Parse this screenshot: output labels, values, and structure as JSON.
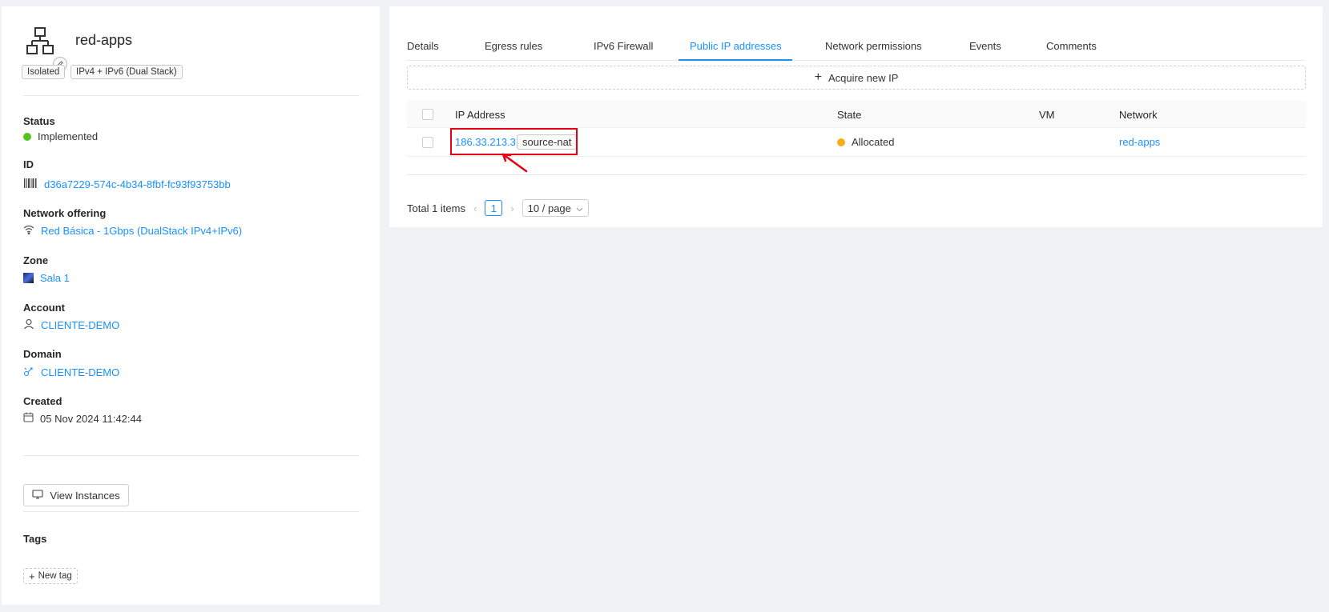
{
  "network": {
    "title": "red-apps",
    "tags": [
      "Isolated",
      "IPv4 + IPv6 (Dual Stack)"
    ]
  },
  "fields": {
    "status": {
      "label": "Status",
      "value": "Implemented",
      "color": "#52c41a"
    },
    "id": {
      "label": "ID",
      "value": "d36a7229-574c-4b34-8fbf-fc93f93753bb"
    },
    "offering": {
      "label": "Network offering",
      "value": "Red Básica - 1Gbps (DualStack IPv4+IPv6)"
    },
    "zone": {
      "label": "Zone",
      "value": "Sala 1"
    },
    "account": {
      "label": "Account",
      "value": "CLIENTE-DEMO"
    },
    "domain": {
      "label": "Domain",
      "value": "CLIENTE-DEMO"
    },
    "created": {
      "label": "Created",
      "value": "05 Nov 2024 11:42:44"
    }
  },
  "actions": {
    "view_instances": "View Instances"
  },
  "tags_section": {
    "label": "Tags",
    "new_tag": "New tag"
  },
  "tabs": [
    "Details",
    "Egress rules",
    "IPv6 Firewall",
    "Public IP addresses",
    "Network permissions",
    "Events",
    "Comments"
  ],
  "active_tab": "Public IP addresses",
  "acquire_label": "Acquire new IP",
  "table": {
    "columns": [
      "IP Address",
      "State",
      "VM",
      "Network"
    ],
    "rows": [
      {
        "ip": "186.33.213.3",
        "badge": "source-nat",
        "state": "Allocated",
        "state_color": "#faad14",
        "vm": "",
        "network": "red-apps"
      }
    ]
  },
  "pagination": {
    "total": "Total 1 items",
    "page": "1",
    "page_size": "10 / page"
  },
  "colors": {
    "accent": "#1890ff",
    "highlight": "#e60012"
  }
}
